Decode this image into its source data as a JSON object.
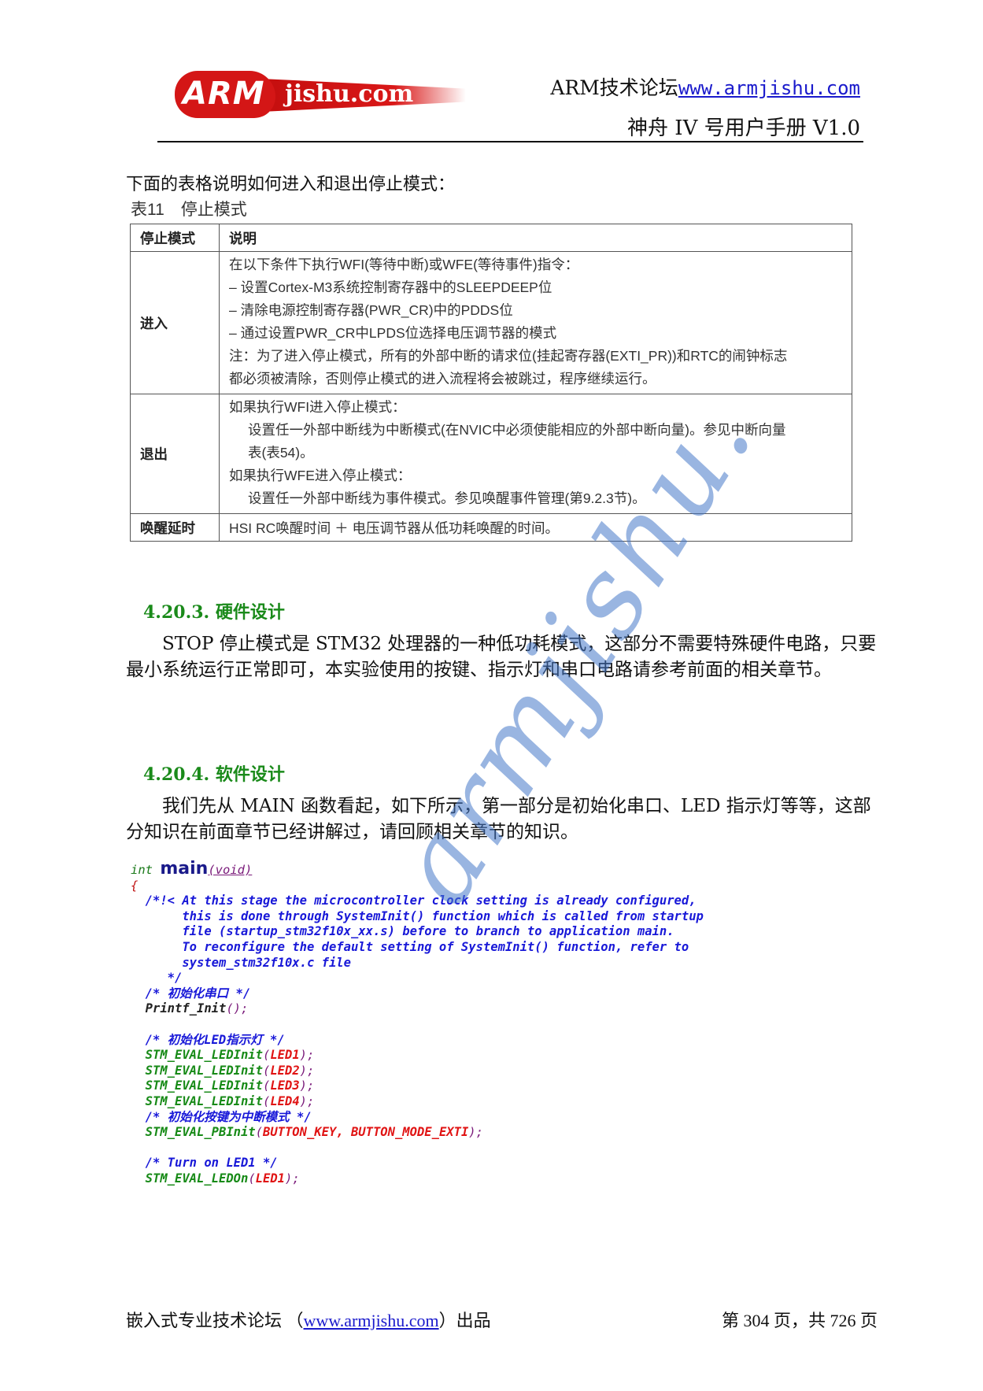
{
  "header": {
    "logo": {
      "left": "ARM",
      "right": "jishu.com"
    },
    "forum_label": "ARM技术论坛",
    "forum_url": "www.armjishu.com",
    "manual_title": "神舟 IV 号用户手册 V1.0"
  },
  "intro": "下面的表格说明如何进入和退出停止模式：",
  "table": {
    "caption": "表11　停止模式",
    "headers": [
      "停止模式",
      "说明"
    ],
    "rows": [
      {
        "label": "进入",
        "lines": [
          "在以下条件下执行WFI(等待中断)或WFE(等待事件)指令：",
          "– 设置Cortex-M3系统控制寄存器中的SLEEPDEEP位",
          "– 清除电源控制寄存器(PWR_CR)中的PDDS位",
          "– 通过设置PWR_CR中LPDS位选择电压调节器的模式",
          "注：为了进入停止模式，所有的外部中断的请求位(挂起寄存器(EXTI_PR))和RTC的闹钟标志",
          "都必须被清除，否则停止模式的进入流程将会被跳过，程序继续运行。"
        ]
      },
      {
        "label": "退出",
        "lines": [
          "如果执行WFI进入停止模式：",
          "设置任一外部中断线为中断模式(在NVIC中必须使能相应的外部中断向量)。参见中断向量",
          "表(表54)。",
          "如果执行WFE进入停止模式：",
          "设置任一外部中断线为事件模式。参见唤醒事件管理(第9.2.3节)。"
        ]
      },
      {
        "label": "唤醒延时",
        "lines": [
          "HSI RC唤醒时间 ＋ 电压调节器从低功耗唤醒的时间。"
        ]
      }
    ]
  },
  "sections": [
    {
      "title": "4.20.3. 硬件设计",
      "paragraph": "　　STOP 停止模式是 STM32 处理器的一种低功耗模式，这部分不需要特殊硬件电路，只要最小系统运行正常即可，本实验使用的按键、指示灯和串口电路请参考前面的相关章节。"
    },
    {
      "title": "4.20.4. 软件设计",
      "paragraph": "　　我们先从 MAIN 函数看起，如下所示，第一部分是初始化串口、LED 指示灯等等，这部分知识在前面章节已经讲解过，请回顾相关章节的知识。"
    }
  ],
  "code": {
    "sig_type": "int",
    "sig_name": "main",
    "sig_params": "(void)",
    "open_brace": "{",
    "comment_block": [
      "  /*!< At this stage the microcontroller clock setting is already configured,",
      "       this is done through SystemInit() function which is called from startup",
      "       file (startup_stm32f10x_xx.s) before to branch to application main.",
      "       To reconfigure the default setting of SystemInit() function, refer to",
      "       system_stm32f10x.c file",
      "     */"
    ],
    "comment_uart": "  /* 初始化串口 */",
    "printf_name": "  Printf_Init",
    "printf_args": "();",
    "comment_led": "  /* 初始化LED指示灯 */",
    "led_inits": [
      {
        "fn": "  STM_EVAL_LEDInit",
        "arg": "LED1"
      },
      {
        "fn": "  STM_EVAL_LEDInit",
        "arg": "LED2"
      },
      {
        "fn": "  STM_EVAL_LEDInit",
        "arg": "LED3"
      },
      {
        "fn": "  STM_EVAL_LEDInit",
        "arg": "LED4"
      }
    ],
    "comment_key": "  /* 初始化按键为中断模式 */",
    "pb_fn": "  STM_EVAL_PBInit",
    "pb_args": "BUTTON_KEY, BUTTON_MODE_EXTI",
    "comment_on": "  /* Turn on LED1 */",
    "on_fn": "  STM_EVAL_LEDOn",
    "on_arg": "LED1"
  },
  "watermark": "armjishu.",
  "footer": {
    "left_prefix": "嵌入式专业技术论坛 （",
    "left_url": "www.armjishu.com",
    "left_suffix": "）出品",
    "page_info": "第 304 页，共 726 页"
  }
}
